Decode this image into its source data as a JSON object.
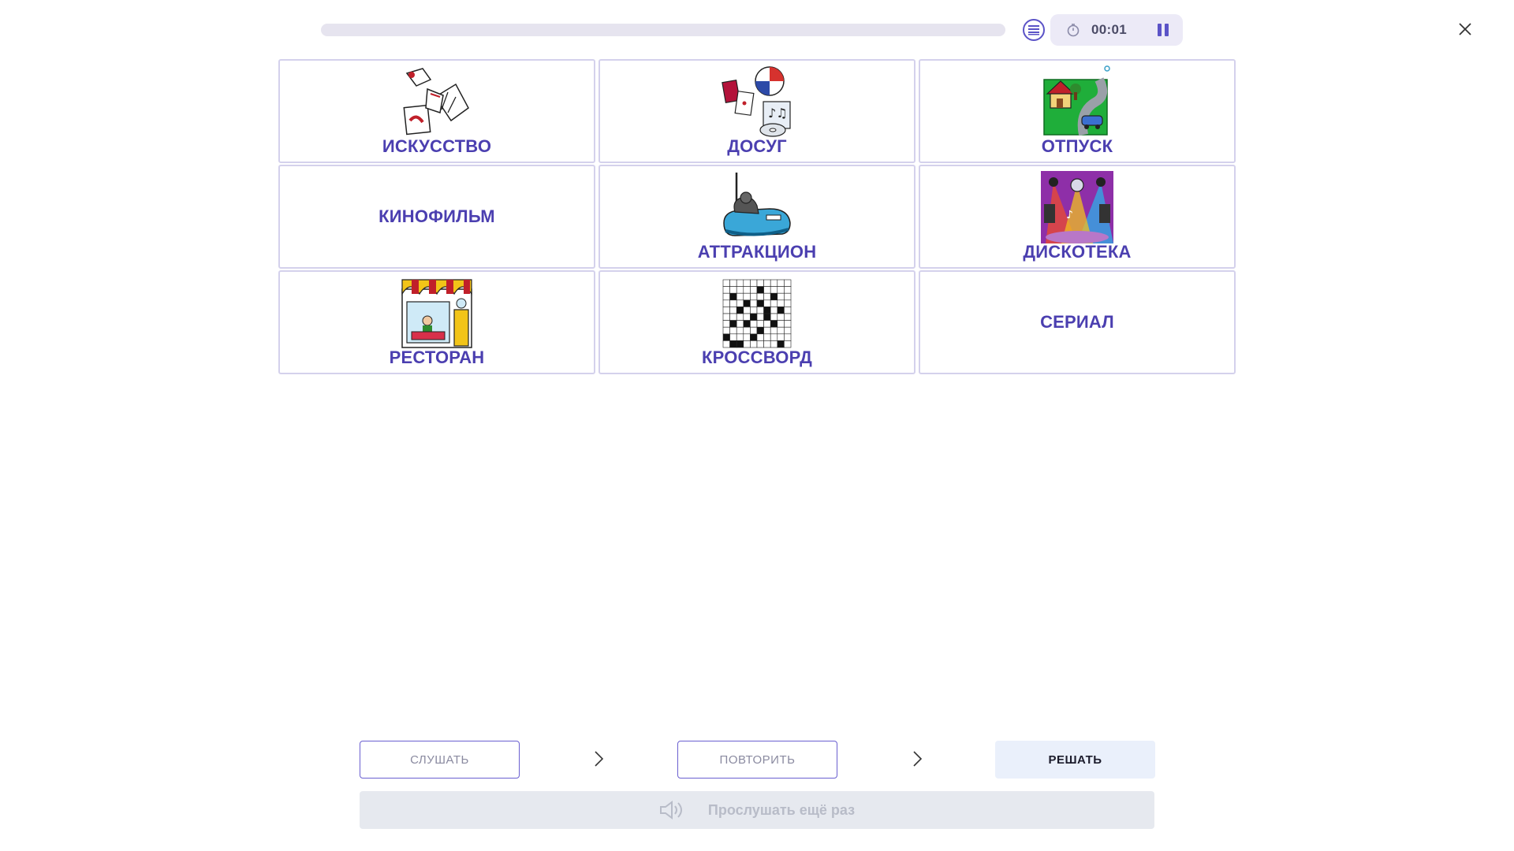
{
  "header": {
    "progress_percent": 0,
    "timer": "00:01",
    "list_icon": "list-icon",
    "timer_icon": "stopwatch-icon",
    "pause_icon": "pause-icon",
    "close_icon": "close-icon"
  },
  "cards": [
    {
      "label": "ИСКУССТВО",
      "icon": "art-hands-icon"
    },
    {
      "label": "ДОСУГ",
      "icon": "leisure-icon"
    },
    {
      "label": "ОТПУСК",
      "icon": "vacation-icon"
    },
    {
      "label": "КИНОФИЛЬМ",
      "icon": ""
    },
    {
      "label": "АТТРАКЦИОН",
      "icon": "bumper-car-icon"
    },
    {
      "label": "ДИСКОТЕКА",
      "icon": "disco-icon"
    },
    {
      "label": "РЕСТОРАН",
      "icon": "restaurant-icon"
    },
    {
      "label": "КРОССВОРД",
      "icon": "crossword-icon"
    },
    {
      "label": "СЕРИАЛ",
      "icon": ""
    }
  ],
  "steps": {
    "listen": "СЛУШАТЬ",
    "repeat": "ПОВТОРИТЬ",
    "solve": "РЕШАТЬ"
  },
  "replay": {
    "label": "Прослушать ещё раз",
    "icon": "speaker-icon"
  },
  "colors": {
    "accent": "#5b53c7",
    "label": "#4b3fb0",
    "card_border": "#d4d1ec"
  }
}
